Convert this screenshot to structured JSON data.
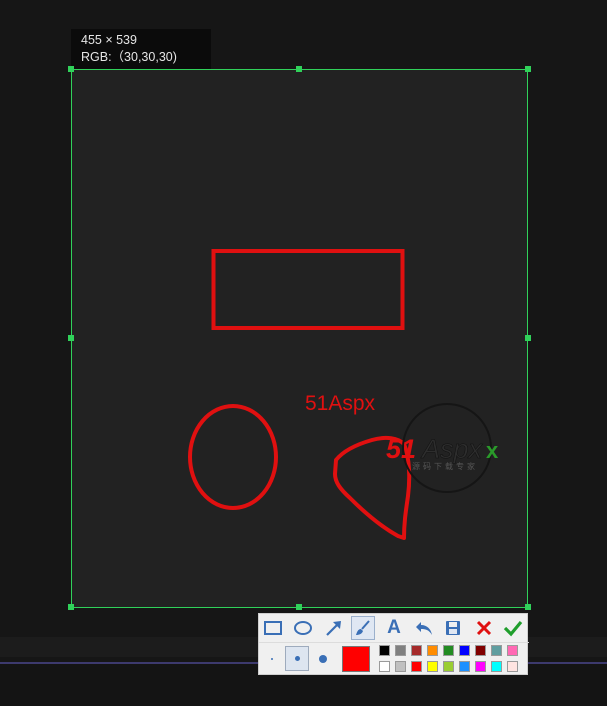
{
  "info": {
    "size_text": "455 × 539",
    "rgb_text": "RGB:（30,30,30)"
  },
  "canvas": {
    "text_annotation": "51Aspx",
    "annotation_color": "#e01010",
    "background_color": "#222222",
    "selection_border_color": "#30d15a"
  },
  "watermark": {
    "brand": "51Aspx",
    "brand_red": "51",
    "brand_gray": "Aspx",
    "brand_x_color": "#2a9a2a",
    "subtext": "源码下载专家"
  },
  "toolbar": {
    "tools": [
      {
        "name": "rectangle-tool",
        "icon": "rectangle-icon"
      },
      {
        "name": "ellipse-tool",
        "icon": "ellipse-icon"
      },
      {
        "name": "arrow-tool",
        "icon": "arrow-icon"
      },
      {
        "name": "brush-tool",
        "icon": "brush-icon",
        "active": true
      },
      {
        "name": "text-tool",
        "icon": "text-icon",
        "glyph": "A"
      },
      {
        "name": "undo-tool",
        "icon": "undo-icon"
      },
      {
        "name": "save-tool",
        "icon": "save-icon"
      },
      {
        "name": "cancel-tool",
        "icon": "close-icon"
      },
      {
        "name": "confirm-tool",
        "icon": "check-icon"
      }
    ],
    "sizes": [
      "small",
      "medium",
      "large"
    ],
    "selected_size": "medium",
    "current_color": "#ff0000",
    "palette_top": [
      "#000000",
      "#808080",
      "#a52a2a",
      "#ff8c00",
      "#228b22",
      "#0000ff",
      "#800000",
      "#5f9ea0",
      "#ff69b4"
    ],
    "palette_bottom": [
      "#ffffff",
      "#c0c0c0",
      "#ff0000",
      "#ffff00",
      "#9acd32",
      "#1e90ff",
      "#ff00ff",
      "#00ffff",
      "#ffe4e1"
    ]
  }
}
